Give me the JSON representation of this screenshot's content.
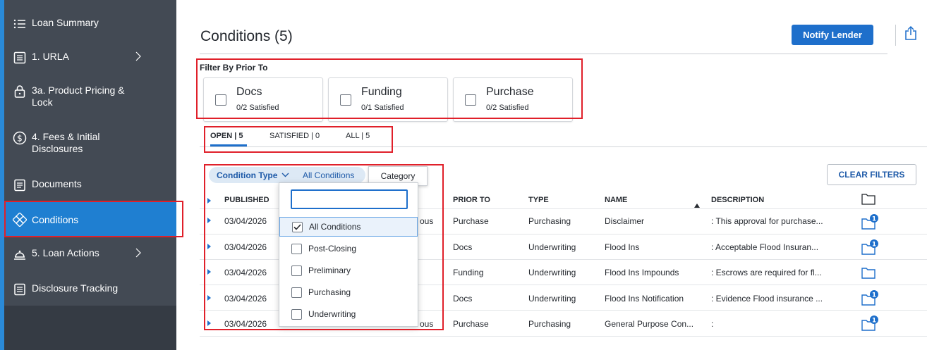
{
  "sidebar": {
    "items": [
      {
        "label": "Loan Summary",
        "icon": "list-icon"
      },
      {
        "label": "1. URLA",
        "icon": "form-icon"
      },
      {
        "label": "3a. Product Pricing & Lock",
        "icon": "lock-icon"
      },
      {
        "label": "4. Fees & Initial Disclosures",
        "icon": "dollar-icon"
      },
      {
        "label": "Documents",
        "icon": "document-icon"
      },
      {
        "label": "Conditions",
        "icon": "conditions-icon"
      },
      {
        "label": "5. Loan Actions",
        "icon": "bell-icon"
      },
      {
        "label": "Disclosure Tracking",
        "icon": "tracking-icon"
      }
    ]
  },
  "header": {
    "title": "Conditions (5)",
    "notify_label": "Notify Lender"
  },
  "filter": {
    "label": "Filter By Prior To",
    "cards": [
      {
        "name": "Docs",
        "sub": "0/2 Satisfied"
      },
      {
        "name": "Funding",
        "sub": "0/1 Satisfied"
      },
      {
        "name": "Purchase",
        "sub": "0/2 Satisfied"
      }
    ]
  },
  "tabs": [
    {
      "label": "OPEN | 5"
    },
    {
      "label": "SATISFIED | 0"
    },
    {
      "label": "ALL | 5"
    }
  ],
  "chips": {
    "condition_type": "Condition Type",
    "all_conditions": "All Conditions",
    "tooltip": "Category"
  },
  "clear_filters": "CLEAR FILTERS",
  "table": {
    "columns": {
      "published": "PUBLISHED",
      "prior_to": "PRIOR TO",
      "type": "TYPE",
      "name": "NAME",
      "description": "DESCRIPTION"
    },
    "rows": [
      {
        "published": "03/04/2026",
        "partial": "ous",
        "prior_to": "Purchase",
        "type": "Purchasing",
        "name": "Disclaimer",
        "description": ": This approval for purchase...",
        "badge": "1"
      },
      {
        "published": "03/04/2026",
        "partial": "",
        "prior_to": "Docs",
        "type": "Underwriting",
        "name": "Flood Ins",
        "description": ": Acceptable Flood Insuran...",
        "badge": "1"
      },
      {
        "published": "03/04/2026",
        "partial": "",
        "prior_to": "Funding",
        "type": "Underwriting",
        "name": "Flood Ins Impounds",
        "description": ": Escrows are required for fl...",
        "badge": ""
      },
      {
        "published": "03/04/2026",
        "partial": "",
        "prior_to": "Docs",
        "type": "Underwriting",
        "name": "Flood Ins Notification",
        "description": ": Evidence Flood insurance ...",
        "badge": "1"
      },
      {
        "published": "03/04/2026",
        "partial": "ous",
        "prior_to": "Purchase",
        "type": "Purchasing",
        "name": "General Purpose Con...",
        "description": ":",
        "badge": "1"
      }
    ]
  },
  "dropdown": {
    "search_placeholder": "",
    "options": [
      {
        "label": "All Conditions",
        "checked": true
      },
      {
        "label": "Post-Closing",
        "checked": false
      },
      {
        "label": "Preliminary",
        "checked": false
      },
      {
        "label": "Purchasing",
        "checked": false
      },
      {
        "label": "Underwriting",
        "checked": false
      }
    ]
  },
  "colors": {
    "sidebar_bg": "#434a54",
    "active_nav": "#1f7fd1",
    "accent": "#1e6fcb",
    "highlight_box": "#e0202a"
  }
}
